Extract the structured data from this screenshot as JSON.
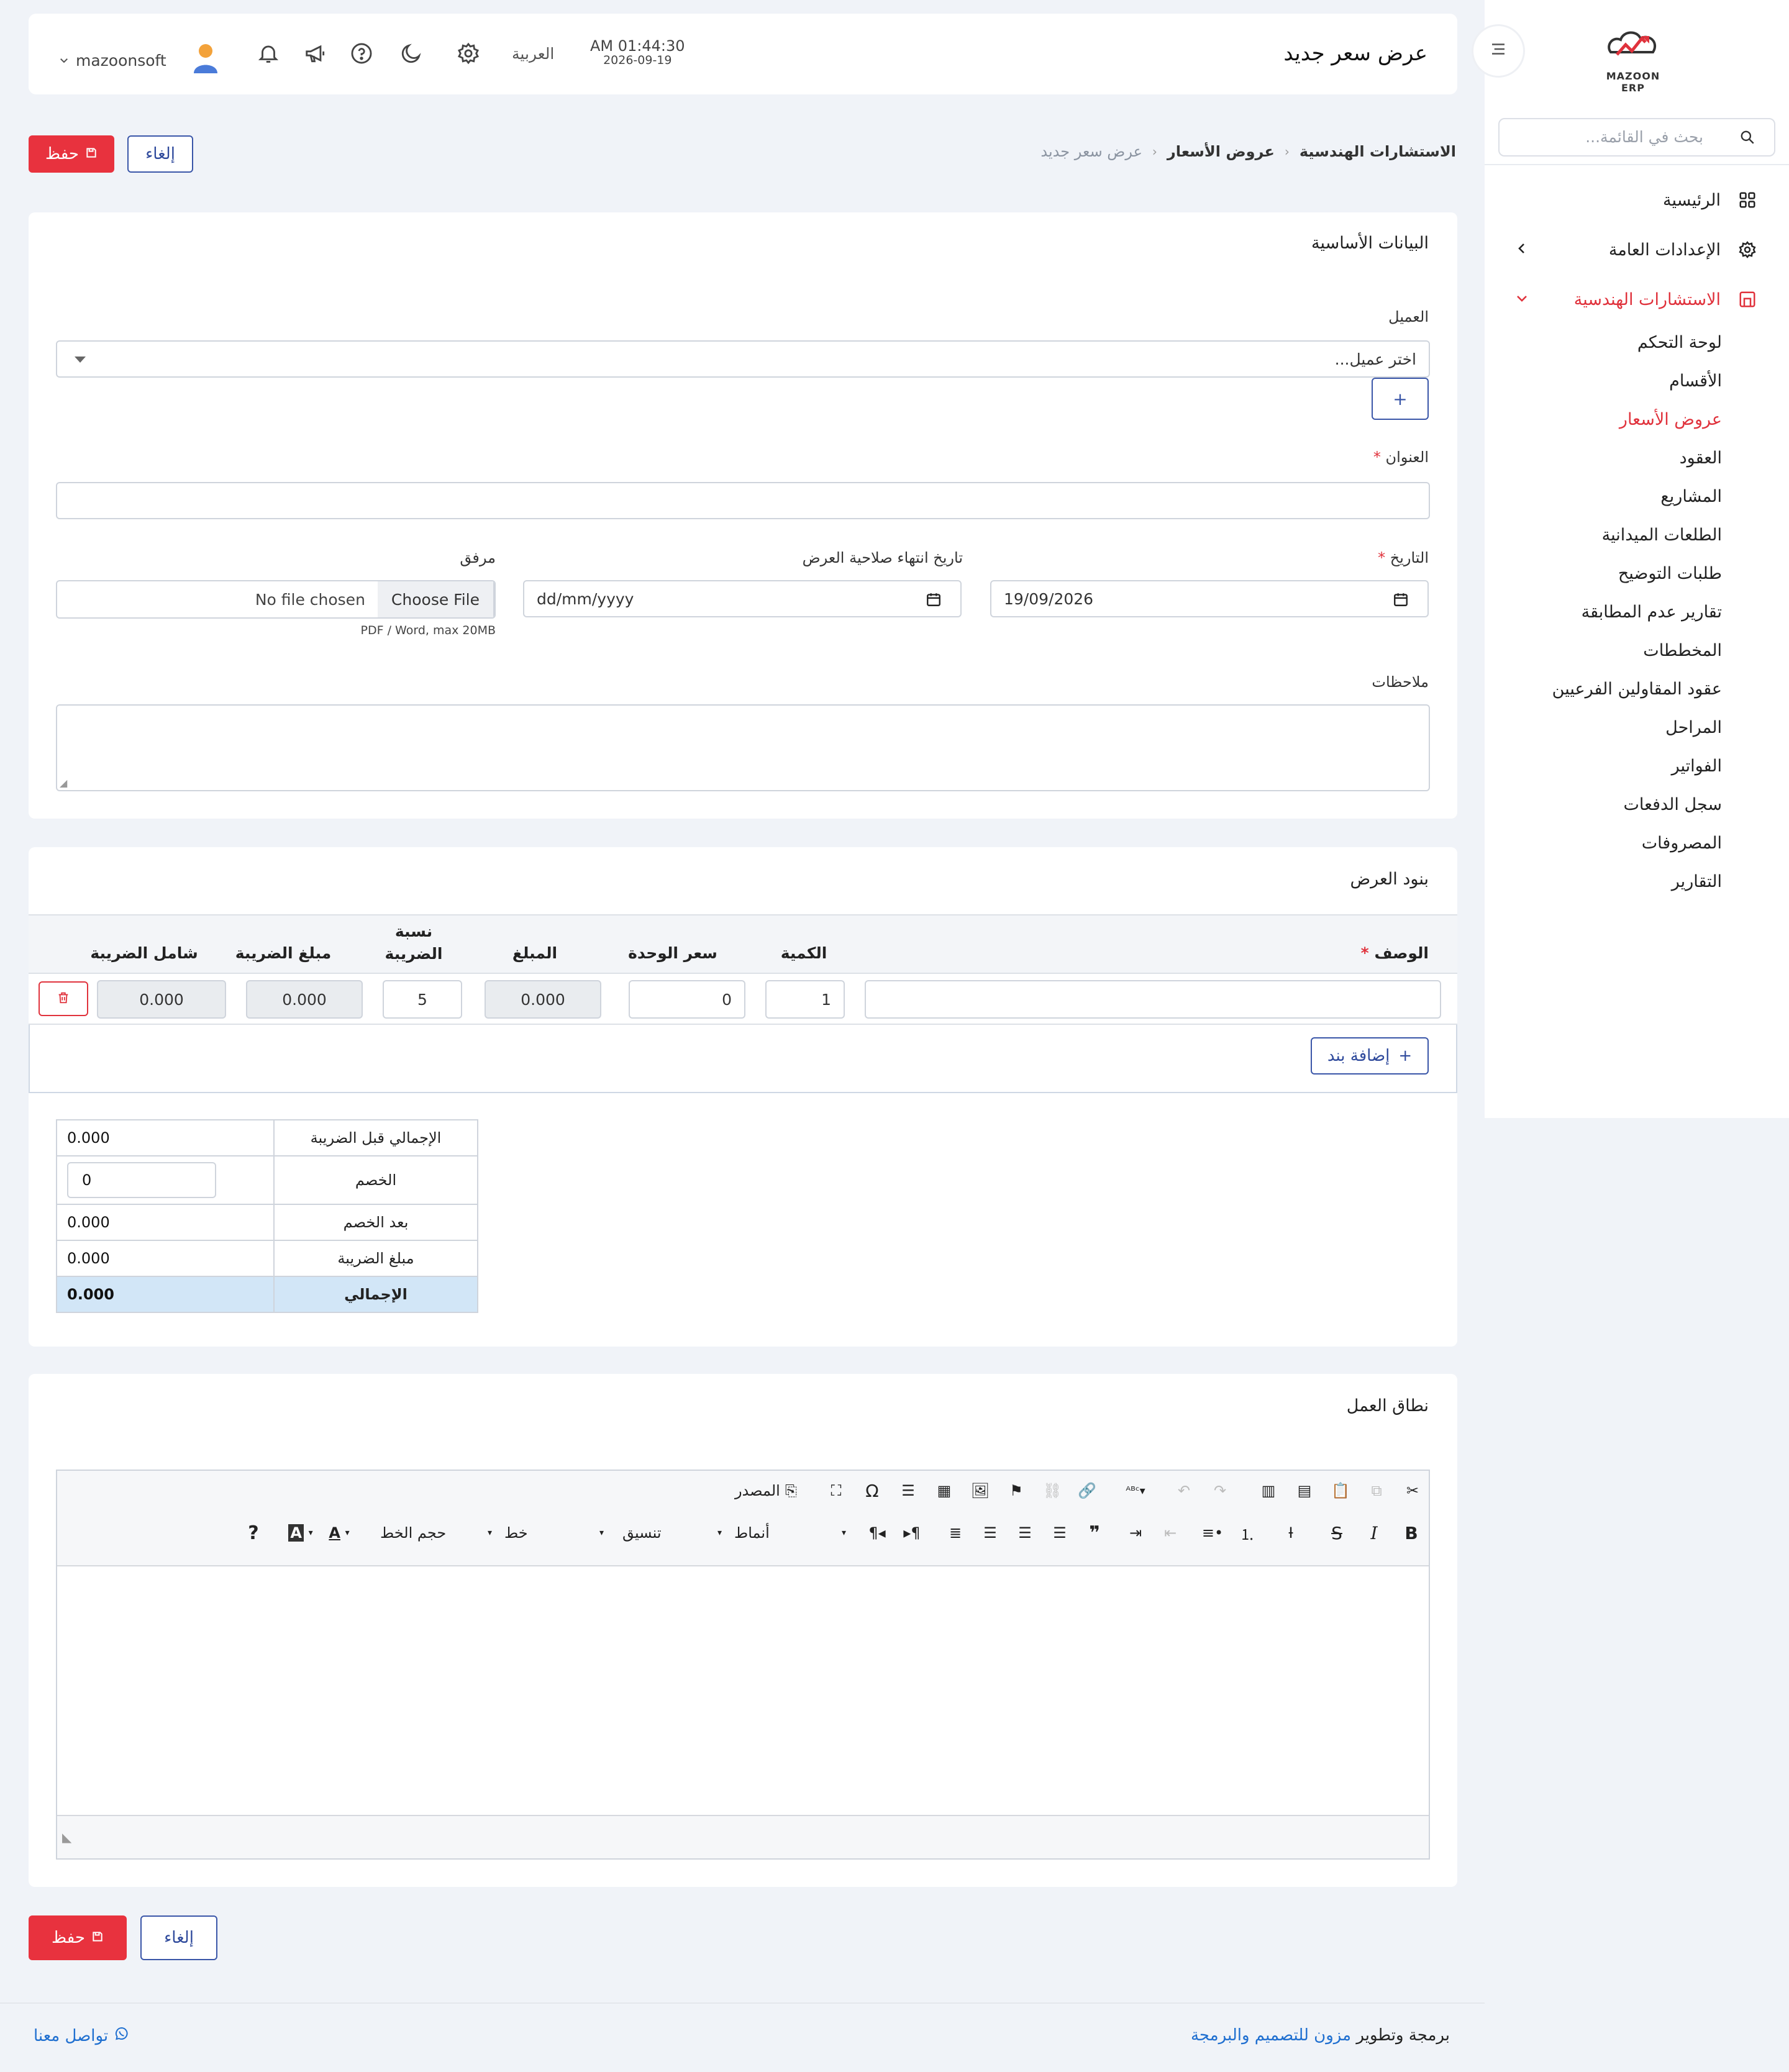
{
  "brand": {
    "name": "MAZOON ERP"
  },
  "sidebar": {
    "search_placeholder": "بحث في القائمة...",
    "items": [
      {
        "label": "الرئيسية"
      },
      {
        "label": "الإعدادات العامة"
      },
      {
        "label": "الاستشارات الهندسية"
      }
    ],
    "sub_items": [
      {
        "label": "لوحة التحكم"
      },
      {
        "label": "الأقسام"
      },
      {
        "label": "عروض الأسعار"
      },
      {
        "label": "العقود"
      },
      {
        "label": "المشاريع"
      },
      {
        "label": "الطلعات الميدانية"
      },
      {
        "label": "طلبات التوضيح"
      },
      {
        "label": "تقارير عدم المطابقة"
      },
      {
        "label": "المخططات"
      },
      {
        "label": "عقود المقاولين الفرعيين"
      },
      {
        "label": "المراحل"
      },
      {
        "label": "الفواتير"
      },
      {
        "label": "سجل الدفعات"
      },
      {
        "label": "المصروفات"
      },
      {
        "label": "التقارير"
      }
    ],
    "active_color": "#e0323c"
  },
  "header": {
    "title": "عرض سعر جديد",
    "time": "AM 01:44:30",
    "date": "2026-09-19",
    "language": "العربية",
    "username": "mazoonsoft"
  },
  "breadcrumb": {
    "root": "الاستشارات الهندسية",
    "parent": "عروض الأسعار",
    "current": "عرض سعر جديد"
  },
  "actions": {
    "save": "حفظ",
    "cancel": "إلغاء"
  },
  "basic": {
    "title": "البيانات الأساسية",
    "client_label": "العميل",
    "client_placeholder": "اختر عميل...",
    "add": "+",
    "subject_label": "العنوان",
    "date_label": "التاريخ",
    "date_value": "19/09/2026",
    "expiry_label": "تاريخ انتهاء صلاحية العرض",
    "expiry_value": "dd/mm/yyyy",
    "attachment_label": "مرفق",
    "choose_file": "Choose File",
    "no_file": "No file chosen",
    "file_hint": "PDF / Word, max 20MB",
    "notes_label": "ملاحظات",
    "required_mark": "*"
  },
  "items": {
    "title": "بنود العرض",
    "columns": {
      "description": "الوصف",
      "quantity": "الكمية",
      "unit_price": "سعر الوحدة",
      "amount": "المبلغ",
      "tax_rate": "نسبة الضريبة",
      "tax_amount": "مبلغ الضريبة",
      "total_incl": "شامل الضريبة"
    },
    "rows": [
      {
        "description": "",
        "quantity": "1",
        "unit_price": "0",
        "amount": "0.000",
        "tax_rate": "5",
        "tax_amount": "0.000",
        "total_incl": "0.000"
      }
    ],
    "add_item": "إضافة بند"
  },
  "summary": {
    "subtotal_label": "الإجمالي قبل الضريبة",
    "subtotal": "0.000",
    "discount_label": "الخصم",
    "discount": "0",
    "after_discount_label": "بعد الخصم",
    "after_discount": "0.000",
    "tax_label": "مبلغ الضريبة",
    "tax": "0.000",
    "total_label": "الإجمالي",
    "total": "0.000"
  },
  "scope": {
    "title": "نطاق العمل",
    "toolbar": {
      "source": "المصدر",
      "styles": "أنماط",
      "format": "تنسيق",
      "font": "خط",
      "size": "حجم الخط",
      "bold": "B",
      "italic": "I",
      "strike": "S",
      "help": "?"
    }
  },
  "footer": {
    "contact": "تواصل معنا",
    "credit_prefix": "برمجة وتطوير",
    "credit_link": "مزون للتصميم والبرمجة"
  }
}
